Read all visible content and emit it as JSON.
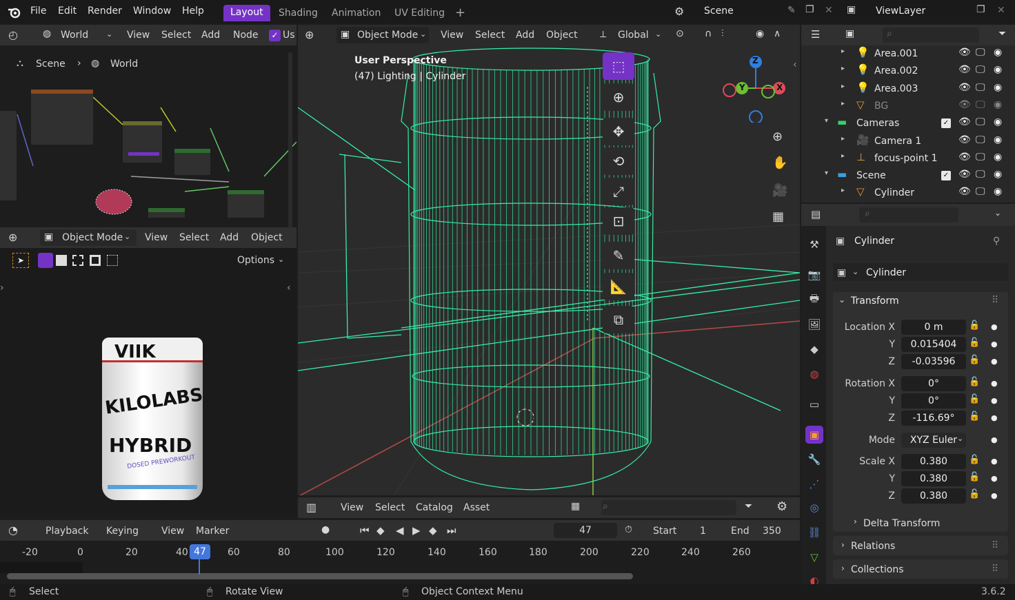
{
  "menu": {
    "file": "File",
    "edit": "Edit",
    "render": "Render",
    "window": "Window",
    "help": "Help"
  },
  "workspaces": [
    "Layout",
    "Shading",
    "Animation",
    "UV Editing",
    "+"
  ],
  "scene_selector": "Scene",
  "viewlayer_selector": "ViewLayer",
  "node_editor": {
    "world_dropdown": "World",
    "view": "View",
    "select": "Select",
    "add": "Add",
    "node": "Node",
    "use_nodes": "Us",
    "breadcrumb": [
      "Scene",
      "World"
    ]
  },
  "small_viewport": {
    "mode": "Object Mode",
    "view": "View",
    "select": "Select",
    "add": "Add",
    "object": "Object",
    "options": "Options",
    "product_top": "VIIK",
    "product_brand": "KILOLABS",
    "product_name": "HYBRID",
    "product_sub": "DOSED PREWORKOUT"
  },
  "viewport": {
    "mode": "Object Mode",
    "view": "View",
    "select": "Select",
    "add": "Add",
    "object": "Object",
    "orientation": "Global",
    "overlay_line1": "User Perspective",
    "overlay_line2": "(47) Lighting | Cylinder",
    "gizmo": {
      "z": "Z",
      "y": "Y",
      "x": "X"
    }
  },
  "asset_bar": {
    "view": "View",
    "select": "Select",
    "catalog": "Catalog",
    "asset": "Asset"
  },
  "timeline": {
    "playback": "Playback",
    "keying": "Keying",
    "view": "View",
    "marker": "Marker",
    "current_frame": "47",
    "start_label": "Start",
    "start": "1",
    "end_label": "End",
    "end": "350",
    "ticks": [
      "-20",
      "0",
      "20",
      "40",
      "60",
      "80",
      "100",
      "120",
      "140",
      "160",
      "180",
      "200",
      "220",
      "240",
      "260"
    ],
    "playhead": "47"
  },
  "outliner": {
    "rows": [
      {
        "name": "Area.001",
        "type": "light"
      },
      {
        "name": "Area.002",
        "type": "light"
      },
      {
        "name": "Area.003",
        "type": "light"
      },
      {
        "name": "BG",
        "type": "mesh"
      },
      {
        "name": "Cameras",
        "type": "collection"
      },
      {
        "name": "Camera 1",
        "type": "camera"
      },
      {
        "name": "focus-point 1",
        "type": "empty"
      },
      {
        "name": "Scene",
        "type": "collection"
      },
      {
        "name": "Cylinder",
        "type": "mesh"
      }
    ]
  },
  "properties": {
    "object_name": "Cylinder",
    "data_name": "Cylinder",
    "transform": "Transform",
    "location_x_label": "Location X",
    "location_x": "0 m",
    "location_y": "0.015404",
    "location_z": "-0.03596",
    "rotation_x_label": "Rotation X",
    "rotation_x": "0°",
    "rotation_y": "0°",
    "rotation_z": "-116.69°",
    "mode_label": "Mode",
    "mode": "XYZ Euler",
    "scale_x_label": "Scale X",
    "scale_x": "0.380",
    "scale_y": "0.380",
    "scale_z": "0.380",
    "y": "Y",
    "z": "Z",
    "delta": "Delta Transform",
    "relations": "Relations",
    "collections": "Collections"
  },
  "statusbar": {
    "select": "Select",
    "rotate": "Rotate View",
    "context": "Object Context Menu",
    "version": "3.6.2"
  },
  "colors": {
    "accent": "#7433c6",
    "wire": "#35f0a8",
    "playhead": "#4477dd"
  }
}
